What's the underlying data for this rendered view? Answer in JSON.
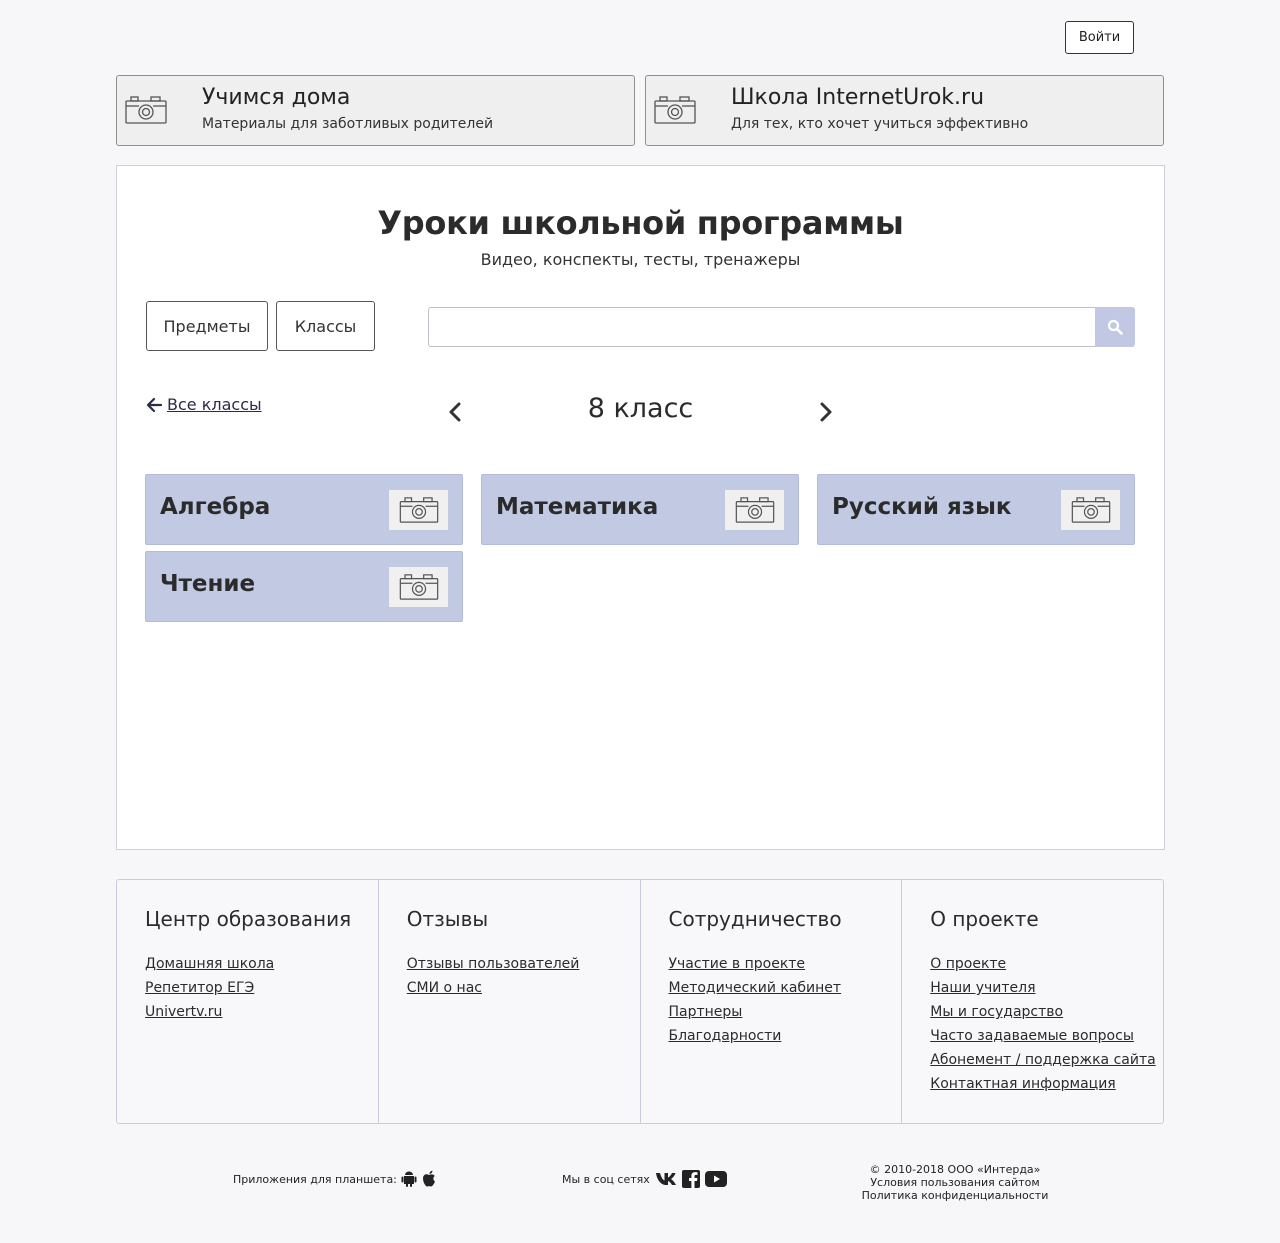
{
  "header": {
    "login_label": "Войти"
  },
  "promos": [
    {
      "title": "Учимся дома",
      "subtitle": "Материалы для заботливых родителей",
      "icon": "camera-icon"
    },
    {
      "title": "Школа InternetUrok.ru",
      "subtitle": "Для тех, кто хочет учиться эффективно",
      "icon": "camera-icon"
    }
  ],
  "main": {
    "title": "Уроки школьной программы",
    "subtitle": "Видео, конспекты, тесты, тренажеры",
    "tabs": {
      "subjects": "Предметы",
      "classes": "Классы"
    },
    "search": {
      "placeholder": "",
      "value": "",
      "icon": "search-icon"
    },
    "back_link": "Все классы",
    "grade": "8 класс",
    "subjects": [
      "Алгебра",
      "Математика",
      "Русский язык",
      "Чтение"
    ],
    "card_color": "#c2c9e2",
    "search_button_color": "#c2c8e3"
  },
  "footer": {
    "columns": [
      {
        "title": "Центр образования",
        "links": [
          "Домашняя школа",
          "Репетитор ЕГЭ",
          "Univertv.ru"
        ]
      },
      {
        "title": "Отзывы",
        "links": [
          "Отзывы пользователей",
          "СМИ о нас"
        ]
      },
      {
        "title": "Сотрудничество",
        "links": [
          "Участие в проекте",
          "Методический кабинет",
          "Партнеры",
          "Благодарности"
        ]
      },
      {
        "title": "О проекте",
        "links": [
          "О проекте",
          "Наши учителя",
          "Мы и государство",
          "Часто задаваемые вопросы",
          "Абонемент / поддержка сайта",
          "Контактная информация"
        ]
      }
    ]
  },
  "bottom": {
    "apps_label": "Приложения для планшета:",
    "social_label": "Мы в соц сетях",
    "copyright": "© 2010-2018 ООО «Интерда»",
    "terms": "Условия пользования сайтом",
    "privacy": "Политика конфиденциальности"
  }
}
